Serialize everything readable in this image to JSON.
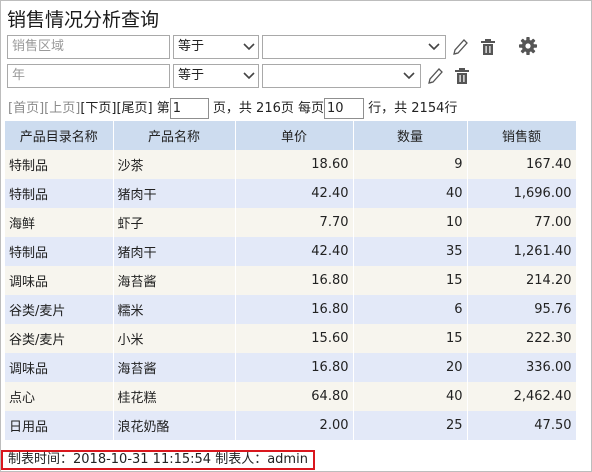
{
  "page": {
    "title": "销售情况分析查询"
  },
  "filters": [
    {
      "field_placeholder": "销售区域",
      "operator": "等于",
      "value": ""
    },
    {
      "field_placeholder": "年",
      "operator": "等于",
      "value": ""
    }
  ],
  "icons": {
    "edit": "pencil-icon",
    "delete": "trash-icon",
    "settings": "gear-icon"
  },
  "pager": {
    "first": "[首页]",
    "prev": "[上页]",
    "next": "[下页]",
    "last": "[尾页]",
    "page_prefix": "第",
    "current_page": "1",
    "page_suffix": "页，共 216页 每页",
    "page_size": "10",
    "rows_suffix": "行，共 2154行"
  },
  "table": {
    "columns": [
      "产品目录名称",
      "产品名称",
      "单价",
      "数量",
      "销售额"
    ],
    "rows": [
      [
        "特制品",
        "沙茶",
        "18.60",
        "9",
        "167.40"
      ],
      [
        "特制品",
        "猪肉干",
        "42.40",
        "40",
        "1,696.00"
      ],
      [
        "海鲜",
        "虾子",
        "7.70",
        "10",
        "77.00"
      ],
      [
        "特制品",
        "猪肉干",
        "42.40",
        "35",
        "1,261.40"
      ],
      [
        "调味品",
        "海苔酱",
        "16.80",
        "15",
        "214.20"
      ],
      [
        "谷类/麦片",
        "糯米",
        "16.80",
        "6",
        "95.76"
      ],
      [
        "谷类/麦片",
        "小米",
        "15.60",
        "15",
        "222.30"
      ],
      [
        "调味品",
        "海苔酱",
        "16.80",
        "20",
        "336.00"
      ],
      [
        "点心",
        "桂花糕",
        "64.80",
        "40",
        "2,462.40"
      ],
      [
        "日用品",
        "浪花奶酪",
        "2.00",
        "25",
        "47.50"
      ]
    ]
  },
  "footer": {
    "text": "制表时间：2018-10-31 11:15:54 制表人：admin"
  },
  "colors": {
    "header_bg": "#cddcef",
    "row_odd": "#f7f5ee",
    "row_even": "#e3e9f8",
    "footer_border": "#d9171e"
  }
}
